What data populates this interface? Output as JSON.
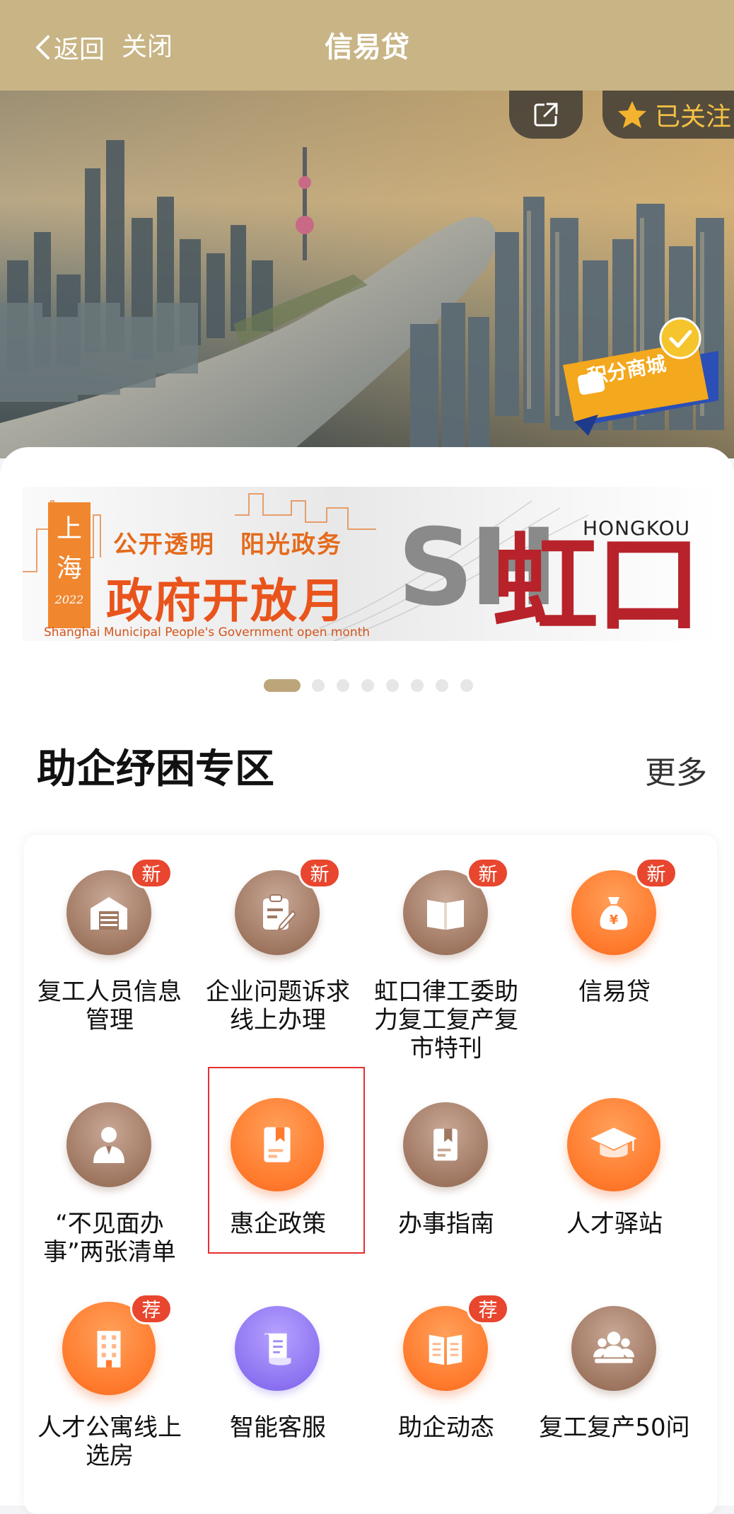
{
  "nav": {
    "back_label": "返回",
    "close_label": "关闭",
    "title": "信易贷"
  },
  "hero": {
    "follow_label": "已关注",
    "points_label": "积分商城"
  },
  "banner": {
    "vertical_text": [
      "上",
      "海",
      "2022"
    ],
    "slogan": "公开透明　阳光政务",
    "main": "政府开放月",
    "english": "Shanghai Municipal People's Government open month",
    "sh": "SH",
    "district": "虹口",
    "district_en": "HONGKOU"
  },
  "carousel": {
    "count": 8,
    "active": 0
  },
  "section": {
    "title": "助企纾困专区",
    "more": "更多"
  },
  "items": [
    {
      "label": "复工人员信息管理",
      "badge": "新",
      "color": "brown",
      "icon": "warehouse-icon"
    },
    {
      "label": "企业问题诉求线上办理",
      "badge": "新",
      "color": "brown",
      "icon": "clipboard-edit-icon"
    },
    {
      "label": "虹口律工委助力复工复产复市特刊",
      "badge": "新",
      "color": "brown",
      "icon": "open-book-icon"
    },
    {
      "label": "信易贷",
      "badge": "新",
      "color": "orange",
      "icon": "money-bag-icon"
    },
    {
      "label": "“不见面办事”两张清单",
      "badge": "",
      "color": "brown",
      "icon": "person-suit-icon"
    },
    {
      "label": "惠企政策",
      "badge": "",
      "color": "orange",
      "icon": "bookmark-doc-icon"
    },
    {
      "label": "办事指南",
      "badge": "",
      "color": "brown",
      "icon": "bookmark-doc-icon"
    },
    {
      "label": "人才驿站",
      "badge": "",
      "color": "orange",
      "icon": "graduation-cap-icon"
    },
    {
      "label": "人才公寓线上选房",
      "badge": "荐",
      "color": "orange",
      "icon": "building-icon"
    },
    {
      "label": "智能客服",
      "badge": "",
      "color": "purple",
      "icon": "scroll-icon"
    },
    {
      "label": "助企动态",
      "badge": "荐",
      "color": "orange",
      "icon": "newspaper-icon"
    },
    {
      "label": "复工复产50问",
      "badge": "",
      "color": "brown",
      "icon": "group-users-icon"
    }
  ],
  "colors": {
    "nav_bg": "#c8b485",
    "accent_orange": "#ff7a2c",
    "accent_brown": "#a07862",
    "badge_red": "#e8462e",
    "dot_active": "#bca579",
    "follow_gold": "#f4c145"
  }
}
